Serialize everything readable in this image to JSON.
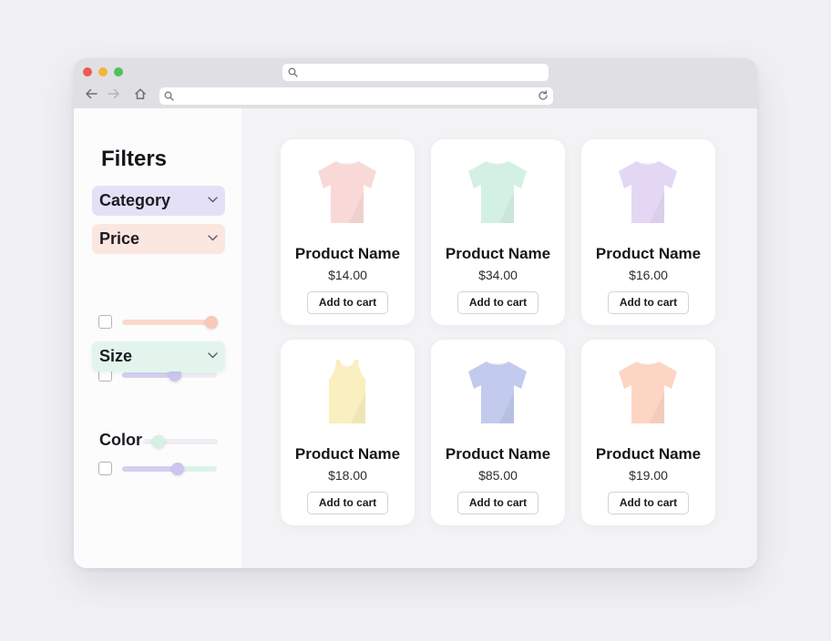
{
  "sidebar": {
    "title": "Filters",
    "sections": {
      "category": {
        "label": "Category"
      },
      "price": {
        "label": "Price"
      },
      "size": {
        "label": "Size"
      },
      "color": {
        "label": "Color"
      }
    }
  },
  "products": [
    {
      "name": "Product Name",
      "price": "$14.00",
      "button": "Add to cart",
      "color": "#f9d9d8",
      "shape": "t-shirt"
    },
    {
      "name": "Product Name",
      "price": "$34.00",
      "button": "Add to cart",
      "color": "#d3f1e2",
      "shape": "t-shirt"
    },
    {
      "name": "Product Name",
      "price": "$16.00",
      "button": "Add to cart",
      "color": "#e3d7f4",
      "shape": "t-shirt"
    },
    {
      "name": "Product Name",
      "price": "$18.00",
      "button": "Add to cart",
      "color": "#faefbf",
      "shape": "tank-top"
    },
    {
      "name": "Product Name",
      "price": "$85.00",
      "button": "Add to cart",
      "color": "#c2cbee",
      "shape": "t-shirt"
    },
    {
      "name": "Product Name",
      "price": "$19.00",
      "button": "Add to cart",
      "color": "#fdd5c3",
      "shape": "t-shirt"
    }
  ],
  "colors": {
    "category_bg": "#e4e1f6",
    "price_bg": "#fbe6e0",
    "size_bg": "#e3f4ec",
    "window_red": "#ee5a52",
    "window_yellow": "#f3b53a",
    "window_green": "#4bc35a"
  },
  "icons": [
    "search-icon",
    "back-arrow-icon",
    "forward-arrow-icon",
    "home-icon",
    "reload-icon",
    "chevron-down-icon"
  ]
}
